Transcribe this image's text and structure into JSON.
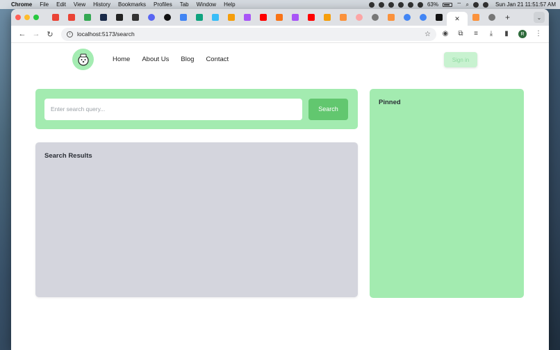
{
  "menubar": {
    "app": "Chrome",
    "items": [
      "File",
      "Edit",
      "View",
      "History",
      "Bookmarks",
      "Profiles",
      "Tab",
      "Window",
      "Help"
    ],
    "battery": "63%",
    "clock": "Sun Jan 21  11:51:57 AM"
  },
  "browser": {
    "url": "localhost:5173/search",
    "profile_initial": "R"
  },
  "site": {
    "nav": [
      "Home",
      "About Us",
      "Blog",
      "Contact"
    ],
    "signin_label": "Sign in"
  },
  "search": {
    "placeholder": "Enter search query...",
    "button_label": "Search"
  },
  "results": {
    "title": "Search Results"
  },
  "pinned": {
    "title": "Pinned"
  },
  "colors": {
    "accent_green": "#a3ebb0",
    "button_green": "#62c76f",
    "results_bg": "#d4d5dd"
  }
}
